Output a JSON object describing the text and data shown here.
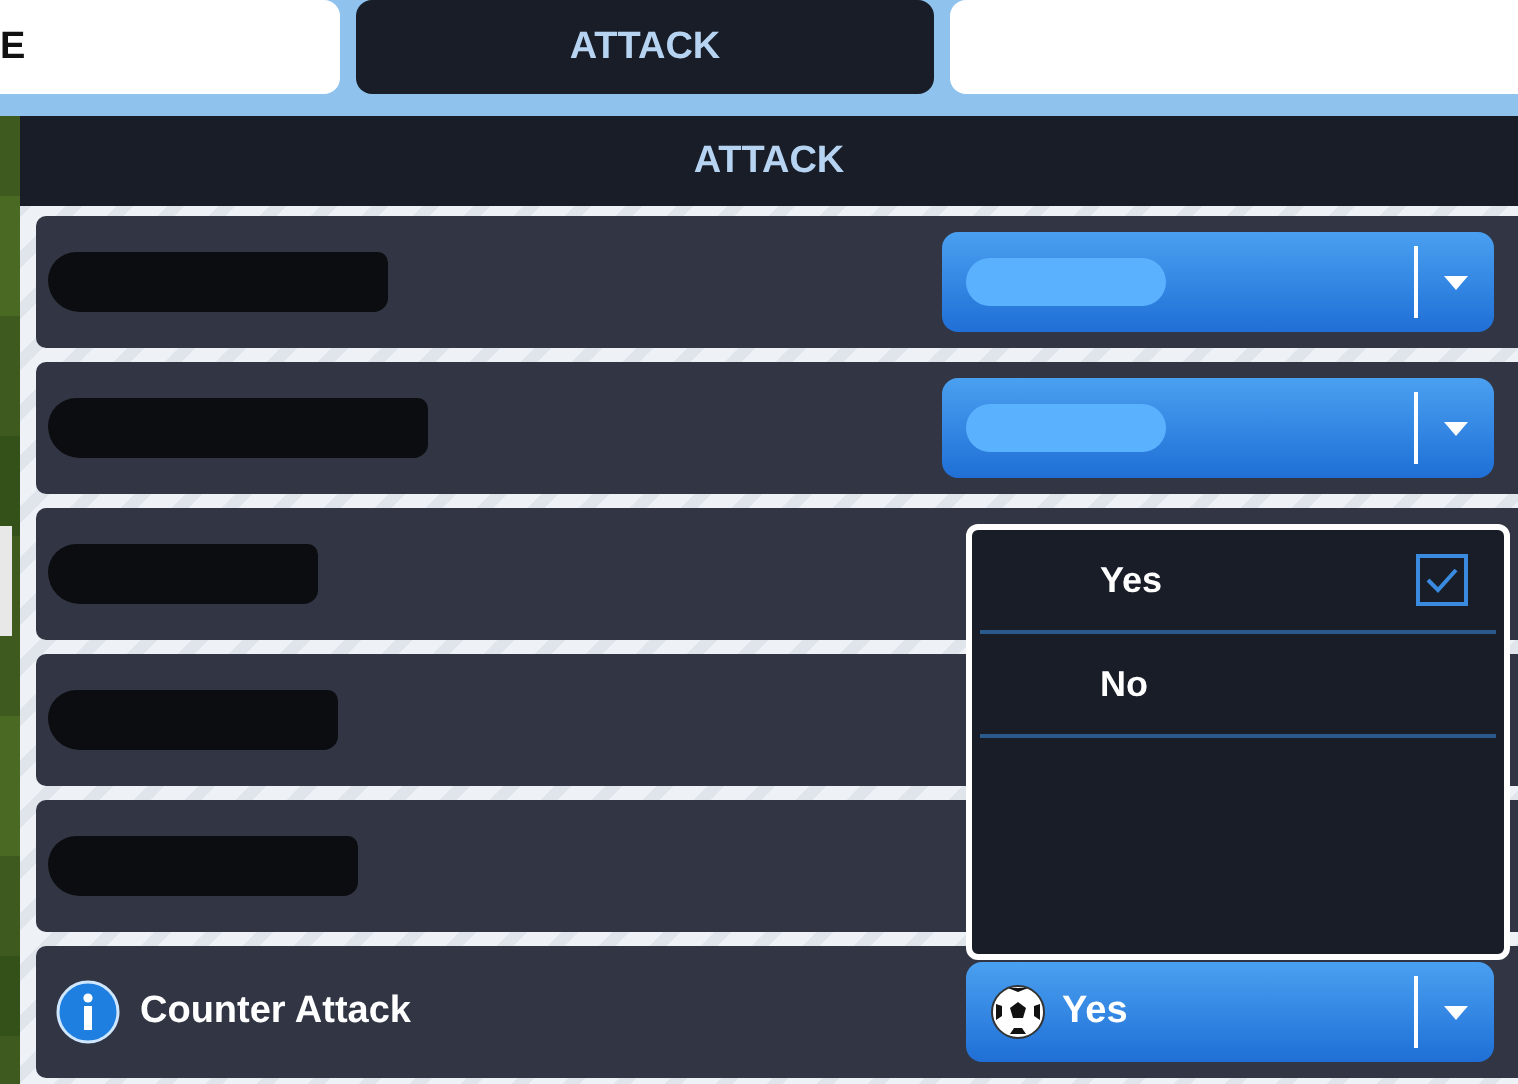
{
  "tabs": [
    {
      "label": "E",
      "selected": false
    },
    {
      "label": "ATTACK",
      "selected": true
    },
    {
      "selected": false
    }
  ],
  "panel": {
    "title": "ATTACK"
  },
  "rows": [
    {
      "kind": "redacted",
      "has_dropdown": true
    },
    {
      "kind": "redacted",
      "has_dropdown": true
    },
    {
      "kind": "redacted",
      "has_dropdown": false
    },
    {
      "kind": "redacted",
      "has_dropdown": false
    },
    {
      "kind": "redacted",
      "has_dropdown": false
    },
    {
      "kind": "setting",
      "label": "Counter Attack",
      "value": "Yes"
    }
  ],
  "popup": {
    "options": [
      {
        "label": "Yes",
        "selected": true
      },
      {
        "label": "No",
        "selected": false
      }
    ]
  }
}
